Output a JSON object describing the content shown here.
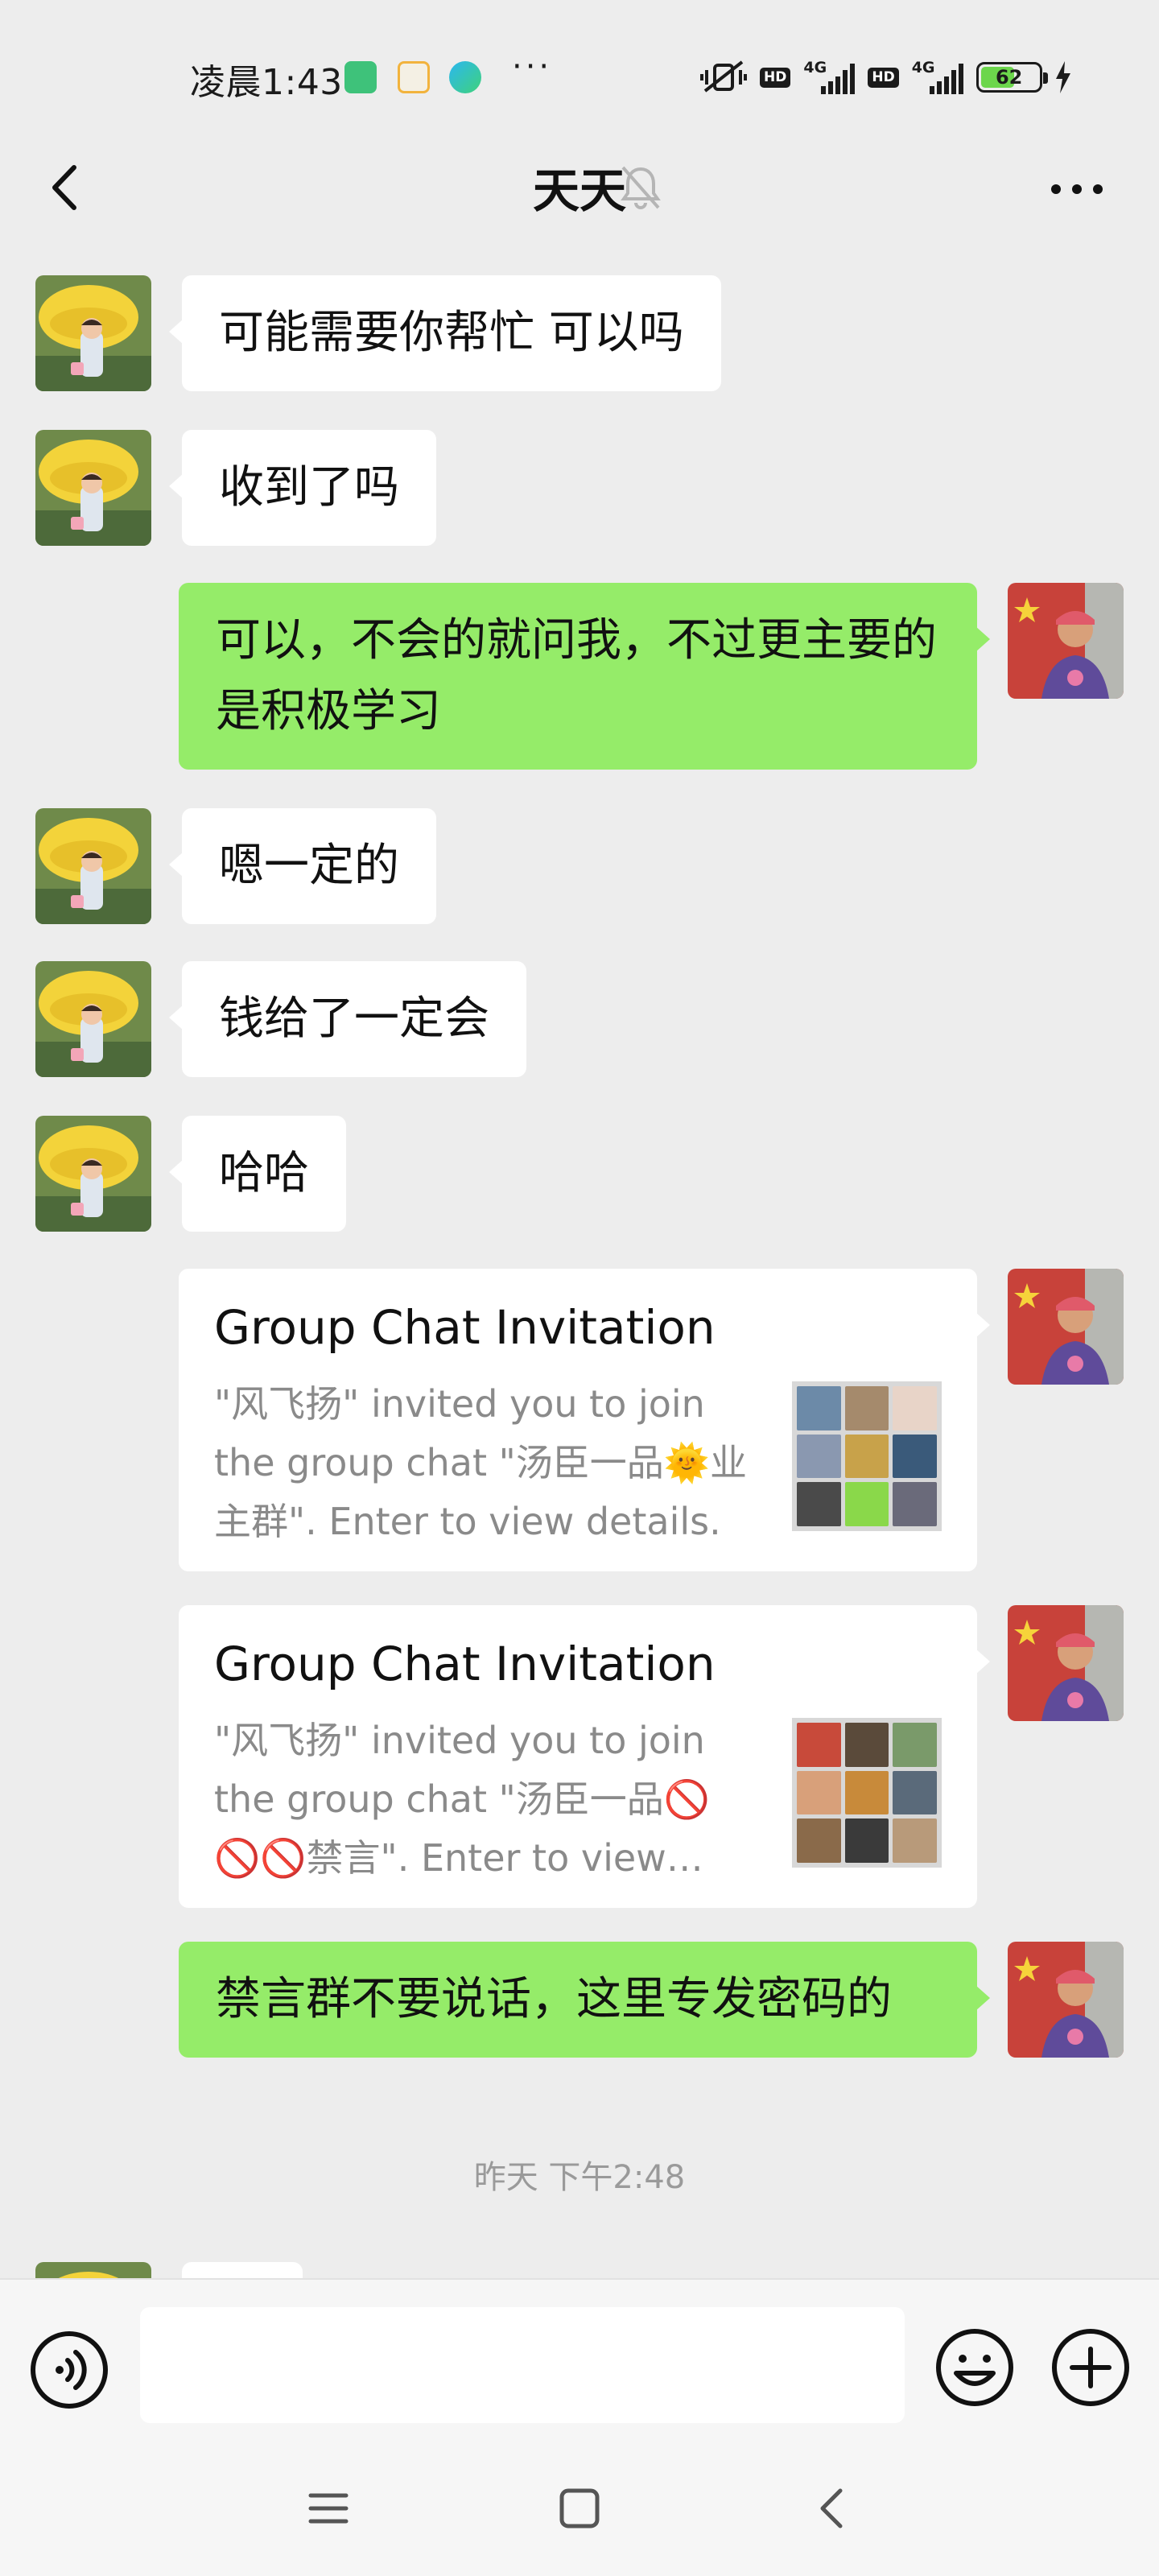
{
  "status_bar": {
    "time": "凌晨1:43",
    "more": "···",
    "hd1": "HD",
    "net1": "4G",
    "hd2": "HD",
    "net2": "4G",
    "battery": "62",
    "battery_fraction": 0.62
  },
  "header": {
    "title": "天天"
  },
  "messages": {
    "m1": "可能需要你帮忙 可以吗",
    "m2": "收到了吗",
    "m3": "可以，不会的就问我，不过更主要的是积极学习",
    "m4": "嗯一定的",
    "m5": "钱给了一定会",
    "m6": "哈哈",
    "card1": {
      "title": "Group Chat Invitation",
      "desc": "\"风飞扬\" invited you to join the group chat \"汤臣一品🌞业主群\". Enter to view details."
    },
    "card2": {
      "title": "Group Chat Invitation",
      "desc": "\"风飞扬\" invited you to join the group chat \"汤臣一品🚫🚫🚫禁言\". Enter to view details."
    },
    "m7": "禁言群不要说话，这里专发密码的"
  },
  "timestamp": "昨天 下午2:48",
  "input": {
    "placeholder": ""
  },
  "colors": {
    "background": "#ededed",
    "my_bubble": "#95ec69",
    "their_bubble": "#ffffff"
  }
}
